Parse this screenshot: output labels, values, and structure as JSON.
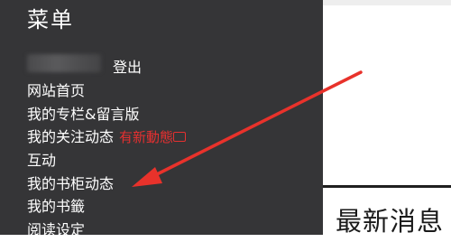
{
  "menu": {
    "title": "菜单",
    "logout": "登出",
    "items": [
      {
        "label": "网站首页"
      },
      {
        "label": "我的专栏&留言版"
      },
      {
        "label": "我的关注动态",
        "badge": "有新動態"
      },
      {
        "label": "互动"
      },
      {
        "label": "我的书柜动态"
      },
      {
        "label": "我的书籤"
      },
      {
        "label": "阅读设定"
      }
    ]
  },
  "content": {
    "heading": "最新消息"
  },
  "colors": {
    "panel": "#353537",
    "badge": "#e53030",
    "arrow": "#e8322b"
  }
}
